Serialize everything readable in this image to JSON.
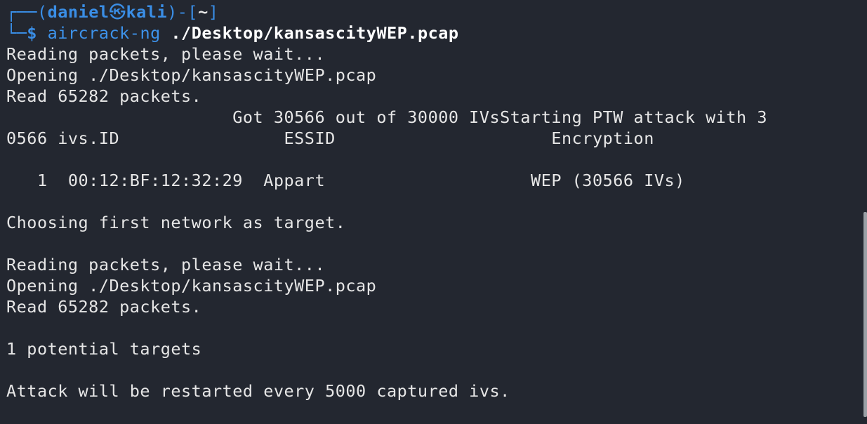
{
  "prompt": {
    "corner_top": "┌──",
    "open_paren": "(",
    "user": "daniel",
    "at_symbol": "㉿",
    "host": "kali",
    "close_paren": ")",
    "dash": "-",
    "dir_open": "[",
    "dir": "~",
    "dir_close": "]",
    "corner_bottom": "└─",
    "dollar": "$",
    "command": "aircrack-ng",
    "argument": "./Desktop/kansascityWEP.pcap"
  },
  "output": [
    "Reading packets, please wait...",
    "Opening ./Desktop/kansascityWEP.pcap",
    "Read 65282 packets.",
    "                      Got 30566 out of 30000 IVsStarting PTW attack with 3",
    "0566 ivs.ID                ESSID                     Encryption",
    "",
    "   1  00:12:BF:12:32:29  Appart                    WEP (30566 IVs)",
    "",
    "Choosing first network as target.",
    "",
    "Reading packets, please wait...",
    "Opening ./Desktop/kansascityWEP.pcap",
    "Read 65282 packets.",
    "",
    "1 potential targets",
    "",
    "Attack will be restarted every 5000 captured ivs."
  ]
}
